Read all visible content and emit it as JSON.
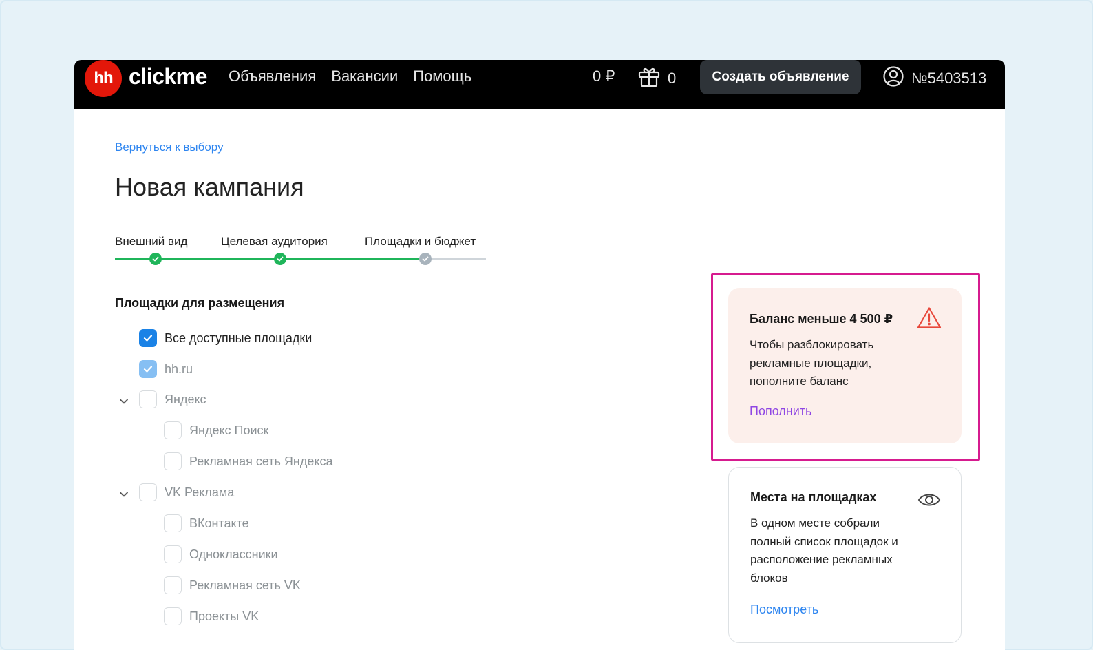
{
  "header": {
    "logo_mark": "hh",
    "logo_text": "clickme",
    "nav": [
      "Объявления",
      "Вакансии",
      "Помощь"
    ],
    "balance": "0 ₽",
    "gifts": "0",
    "create_button": "Создать объявление",
    "account_id": "№5403513"
  },
  "main": {
    "back_link": "Вернуться к выбору",
    "title": "Новая кампания",
    "steps": [
      {
        "label": "Внешний вид",
        "status": "done"
      },
      {
        "label": "Целевая аудитория",
        "status": "done"
      },
      {
        "label": "Площадки и бюджет",
        "status": "current"
      }
    ],
    "platforms_title": "Площадки для размещения",
    "platforms": [
      {
        "label": "Все доступные площадки",
        "checked": true
      },
      {
        "label": "hh.ru",
        "checked": true,
        "disabled": true
      },
      {
        "label": "Яндекс",
        "checked": false,
        "expanded": true
      },
      {
        "label": "Яндекс Поиск",
        "checked": false
      },
      {
        "label": "Рекламная сеть Яндекса",
        "checked": false
      },
      {
        "label": "VK Реклама",
        "checked": false,
        "expanded": true
      },
      {
        "label": "ВКонтакте",
        "checked": false
      },
      {
        "label": "Одноклассники",
        "checked": false
      },
      {
        "label": "Рекламная сеть VK",
        "checked": false
      },
      {
        "label": "Проекты VK",
        "checked": false
      }
    ]
  },
  "warning_card": {
    "title": "Баланс меньше 4 500 ₽",
    "text": "Чтобы разблокировать рекламные площадки, пополните баланс",
    "link": "Пополнить",
    "icon": "warning-triangle-icon"
  },
  "info_card": {
    "title": "Места на площадках",
    "text": "В одном месте собрали полный список площадок и расположение рекламных блоков",
    "link": "Посмотреть",
    "icon": "eye-icon"
  },
  "colors": {
    "accent_blue": "#2f86f0",
    "step_green": "#1fb55a",
    "warning_red": "#e8483b",
    "highlight_magenta": "#d61b8f",
    "link_purple": "#8f47e3"
  }
}
